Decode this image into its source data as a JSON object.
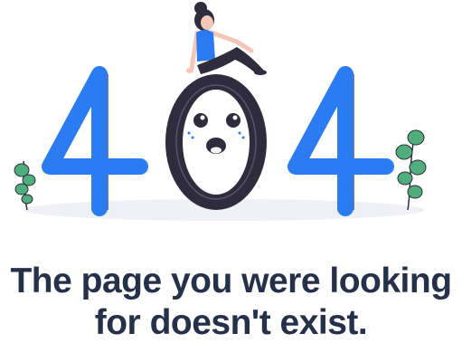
{
  "error_page": {
    "message_line_1": "The page you were looking",
    "message_line_2": "for doesn't exist."
  },
  "illustration": {
    "digits": [
      "4",
      "0",
      "4"
    ],
    "icons": [
      "woman-sitting-icon",
      "face-icon",
      "plant-icon"
    ]
  },
  "colors": {
    "accent_blue": "#2b7cf2",
    "dark": "#2e2c3d",
    "text": "#25304a",
    "leaf_green": "#4fae7b",
    "shadow": "#eef0f5"
  }
}
